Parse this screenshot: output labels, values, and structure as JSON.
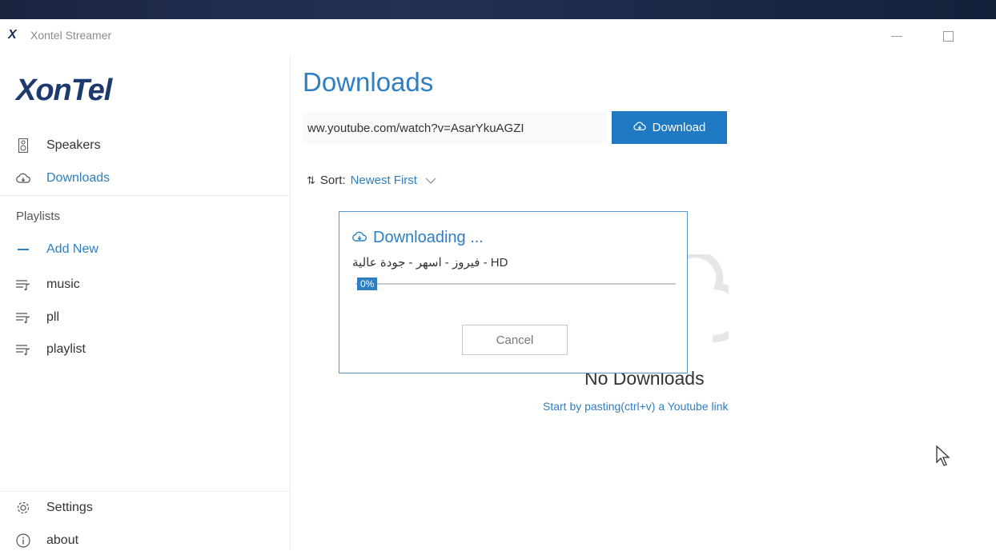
{
  "window": {
    "title": "Xontel Streamer",
    "logo_mark": "X"
  },
  "sidebar": {
    "brand": "XonTel",
    "nav": [
      {
        "label": "Speakers",
        "icon": "speaker-icon"
      },
      {
        "label": "Downloads",
        "icon": "cloud-download-icon",
        "active": true
      }
    ],
    "playlists_title": "Playlists",
    "add_new_label": "Add New",
    "playlists": [
      {
        "label": "music",
        "icon": "playlist-icon"
      },
      {
        "label": "pll",
        "icon": "playlist-icon"
      },
      {
        "label": "playlist",
        "icon": "playlist-icon"
      }
    ],
    "footer": [
      {
        "label": "Settings",
        "icon": "gear-icon"
      },
      {
        "label": "about",
        "icon": "info-icon"
      }
    ]
  },
  "main": {
    "title": "Downloads",
    "url_value": "ww.youtube.com/watch?v=AsarYkuAGZI",
    "download_button": "Download",
    "sort_label": "Sort:",
    "sort_value": "Newest First",
    "empty_title": "No Downloads",
    "empty_hint": "Start by pasting(ctrl+v) a Youtube link"
  },
  "dialog": {
    "title": "Downloading ...",
    "file_name": "فيروز - اسهر - جودة عالية - HD",
    "progress_text": "0%",
    "progress": 0,
    "cancel_label": "Cancel"
  },
  "colors": {
    "accent": "#2d7fc1",
    "button": "#1f7ac3",
    "brand": "#1d3a6e",
    "topbar": "#1a2540"
  }
}
